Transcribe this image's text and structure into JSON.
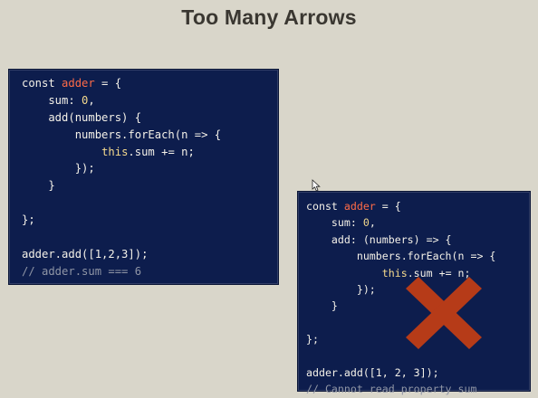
{
  "slide": {
    "title": "Too Many Arrows",
    "cursor_icon": "mouse-pointer-icon",
    "cross_icon": "red-x-icon",
    "colors": {
      "background": "#d9d6ca",
      "code_background": "#0d1d4d",
      "keyword": "#ff6b47",
      "number": "#f5da8d",
      "comment": "#8f95a5",
      "cross": "#b63b18"
    }
  },
  "panels": {
    "left": {
      "lines": [
        [
          {
            "t": "const ",
            "c": "plain"
          },
          {
            "t": "adder",
            "c": "orange"
          },
          {
            "t": " = {",
            "c": "plain"
          }
        ],
        [
          {
            "t": "    sum: ",
            "c": "plain"
          },
          {
            "t": "0",
            "c": "yellow"
          },
          {
            "t": ",",
            "c": "plain"
          }
        ],
        [
          {
            "t": "    add(numbers) {",
            "c": "plain"
          }
        ],
        [
          {
            "t": "        numbers.forEach(n => {",
            "c": "plain"
          }
        ],
        [
          {
            "t": "            ",
            "c": "plain"
          },
          {
            "t": "this",
            "c": "yellow"
          },
          {
            "t": ".sum += n;",
            "c": "plain"
          }
        ],
        [
          {
            "t": "        });",
            "c": "plain"
          }
        ],
        [
          {
            "t": "    }",
            "c": "plain"
          }
        ],
        [
          {
            "t": "",
            "c": "plain"
          }
        ],
        [
          {
            "t": "};",
            "c": "plain"
          }
        ],
        [
          {
            "t": "",
            "c": "plain"
          }
        ],
        [
          {
            "t": "adder.add([1,2,3]);",
            "c": "plain"
          }
        ],
        [
          {
            "t": "// adder.sum === 6",
            "c": "comment"
          }
        ]
      ]
    },
    "right": {
      "lines": [
        [
          {
            "t": "const ",
            "c": "plain"
          },
          {
            "t": "adder",
            "c": "orange"
          },
          {
            "t": " = {",
            "c": "plain"
          }
        ],
        [
          {
            "t": "    sum: ",
            "c": "plain"
          },
          {
            "t": "0",
            "c": "yellow"
          },
          {
            "t": ",",
            "c": "plain"
          }
        ],
        [
          {
            "t": "    add: (numbers) => {",
            "c": "plain"
          }
        ],
        [
          {
            "t": "        numbers.forEach(n => {",
            "c": "plain"
          }
        ],
        [
          {
            "t": "            ",
            "c": "plain"
          },
          {
            "t": "this",
            "c": "yellow"
          },
          {
            "t": ".sum += n;",
            "c": "plain"
          }
        ],
        [
          {
            "t": "        });",
            "c": "plain"
          }
        ],
        [
          {
            "t": "    }",
            "c": "plain"
          }
        ],
        [
          {
            "t": "",
            "c": "plain"
          }
        ],
        [
          {
            "t": "};",
            "c": "plain"
          }
        ],
        [
          {
            "t": "",
            "c": "plain"
          }
        ],
        [
          {
            "t": "adder.add([1, 2, 3]);",
            "c": "plain"
          }
        ],
        [
          {
            "t": "// Cannot read property sum",
            "c": "comment"
          }
        ]
      ]
    }
  }
}
